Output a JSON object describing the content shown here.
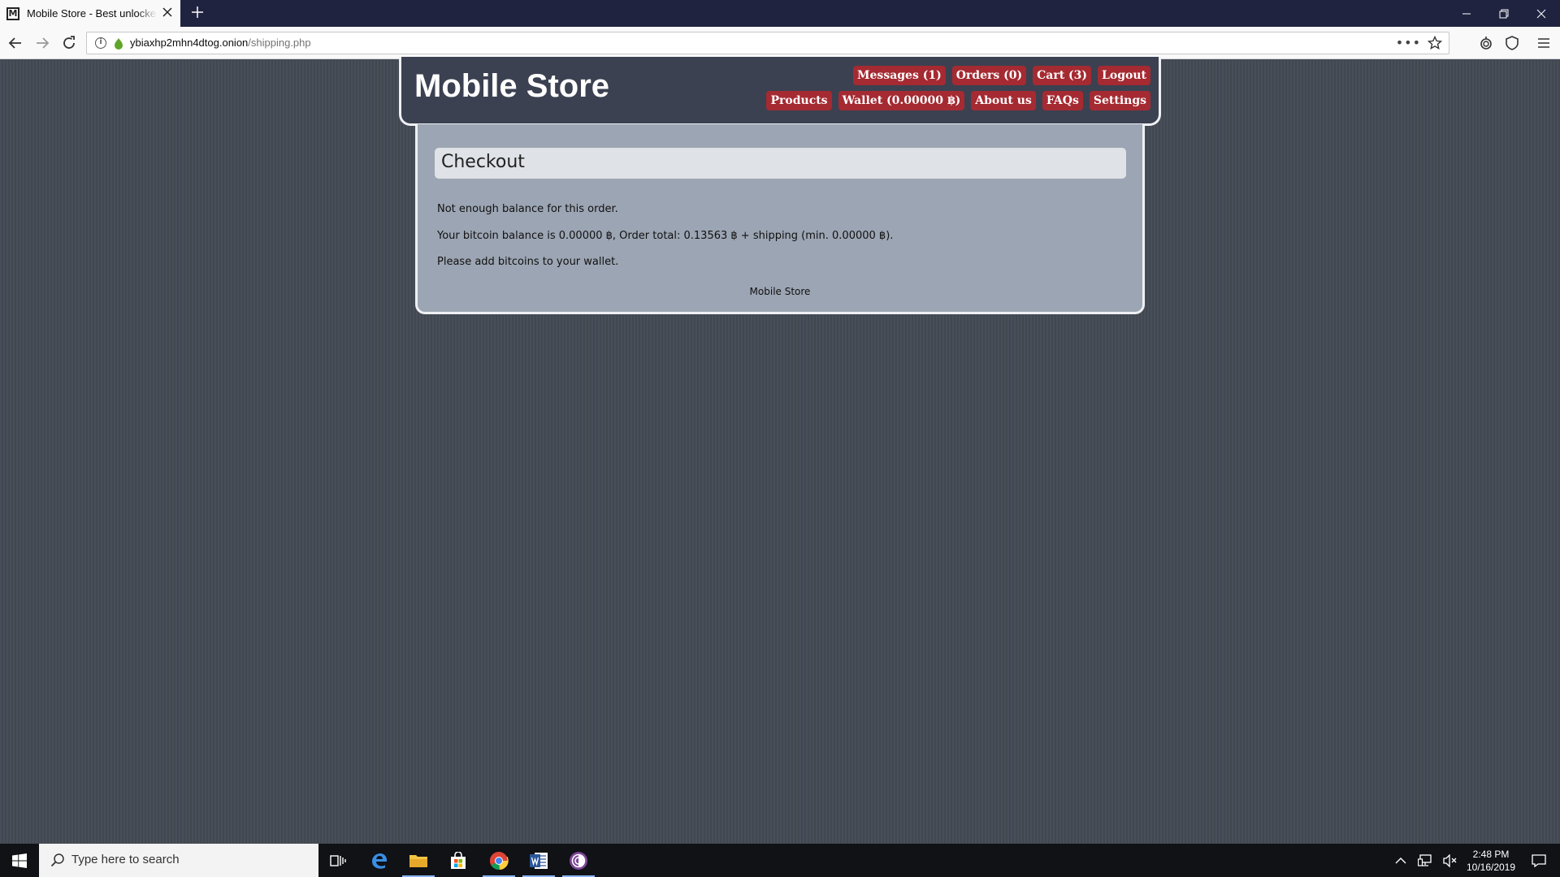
{
  "browser": {
    "tab_title": "Mobile Store - Best unlocked cell",
    "url_domain": "ybiaxhp2mhn4dtog.onion",
    "url_path": "/shipping.php"
  },
  "site": {
    "logo": "Mobile Store",
    "menu_row1": [
      "Messages (1)",
      "Orders (0)",
      "Cart (3)",
      "Logout"
    ],
    "menu_row2": [
      "Products",
      "Wallet (0.00000 ฿)",
      "About us",
      "FAQs",
      "Settings"
    ]
  },
  "checkout": {
    "title": "Checkout",
    "message1": "Not enough balance for this order.",
    "message2": "Your bitcoin balance is 0.00000 ฿, Order total: 0.13563 ฿ + shipping (min. 0.00000 ฿).",
    "message3": "Please add bitcoins to your wallet.",
    "footer": "Mobile Store"
  },
  "taskbar": {
    "search_placeholder": "Type here to search",
    "time": "2:48 PM",
    "date": "10/16/2019"
  }
}
